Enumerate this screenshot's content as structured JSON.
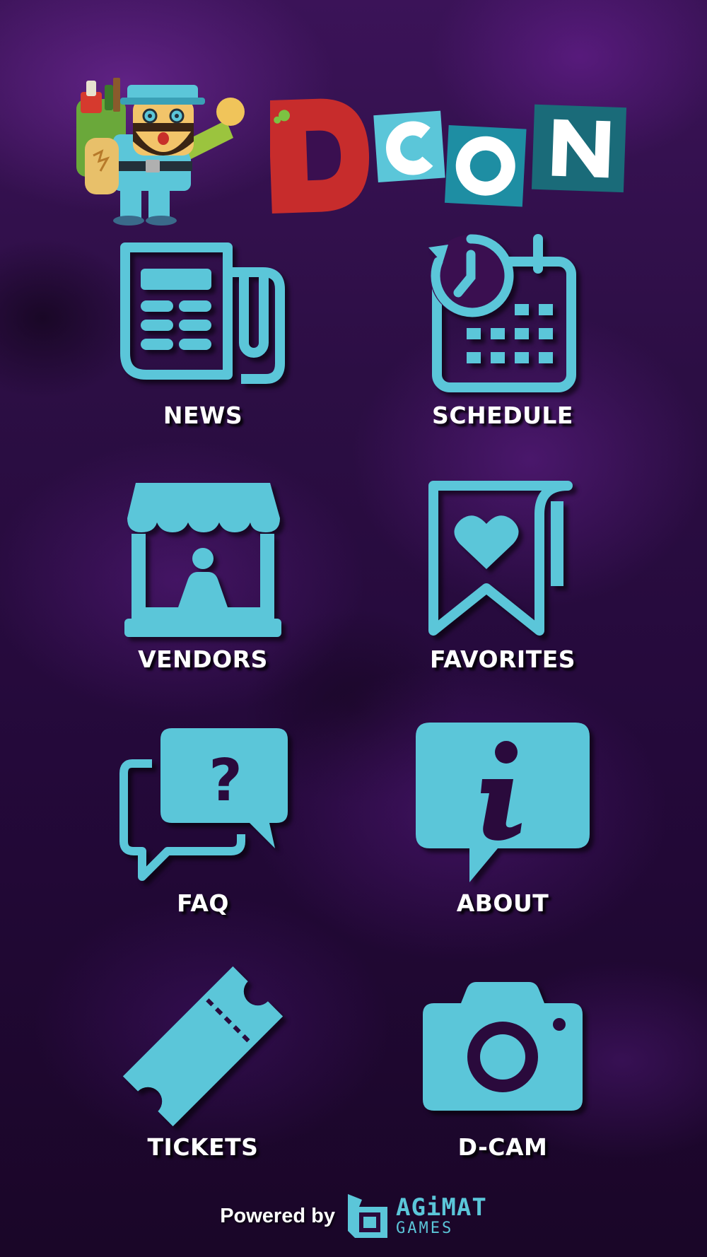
{
  "app": {
    "logo_text": "DCON",
    "brand_colors": {
      "icon": "#5bc6d9",
      "logo_red": "#c72c2c",
      "logo_teal": "#5bc6d9",
      "logo_dark_teal": "#17717f"
    }
  },
  "menu": [
    {
      "id": "news",
      "label": "NEWS",
      "icon": "newspaper-icon"
    },
    {
      "id": "schedule",
      "label": "SCHEDULE",
      "icon": "calendar-clock-icon"
    },
    {
      "id": "vendors",
      "label": "VENDORS",
      "icon": "vendor-booth-icon"
    },
    {
      "id": "favorites",
      "label": "FAVORITES",
      "icon": "heart-bookmark-icon"
    },
    {
      "id": "faq",
      "label": "FAQ",
      "icon": "question-chat-icon"
    },
    {
      "id": "about",
      "label": "ABOUT",
      "icon": "info-chat-icon"
    },
    {
      "id": "tickets",
      "label": "TICKETS",
      "icon": "ticket-icon"
    },
    {
      "id": "dcam",
      "label": "D-CAM",
      "icon": "camera-icon"
    }
  ],
  "footer": {
    "powered_by": "Powered by",
    "brand_line1": "AGiMAT",
    "brand_line2": "GAMES"
  }
}
